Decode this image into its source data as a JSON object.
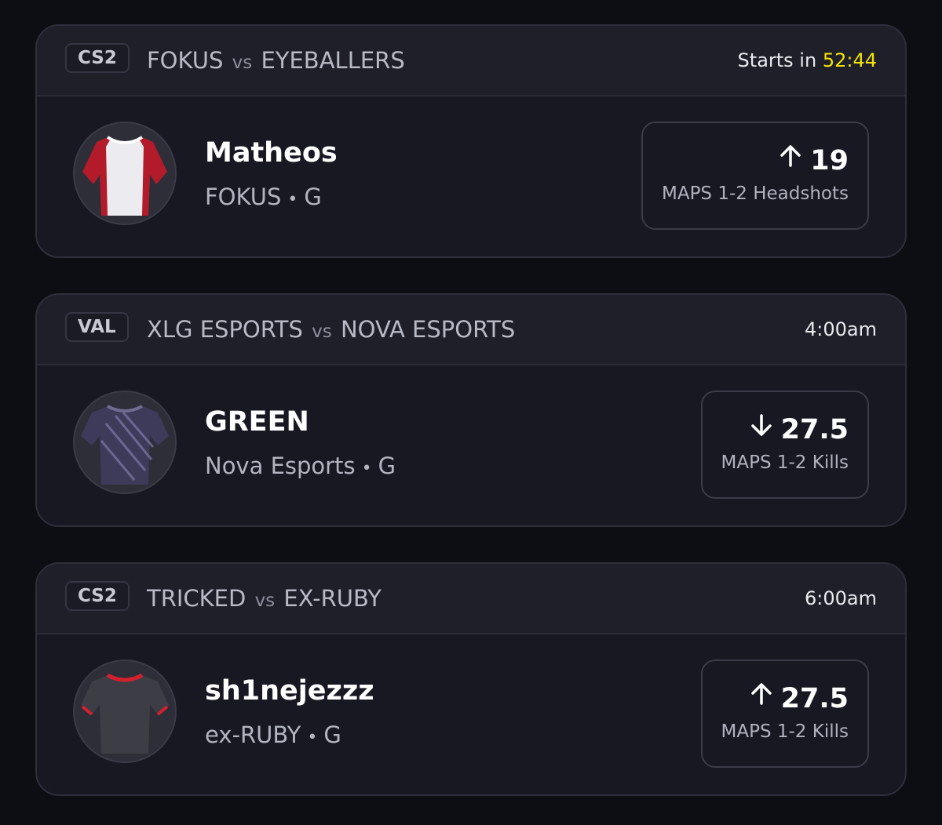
{
  "cards": [
    {
      "game": "CS2",
      "team_a": "FOKUS",
      "vs": "vs",
      "team_b": "EYEBALLERS",
      "time_prefix": "Starts in",
      "countdown": "52:44",
      "time": "",
      "player": "Matheos",
      "team": "FOKUS",
      "position": "G",
      "direction": "up",
      "arrow_icon": "arrow-up-icon",
      "line": "19",
      "stat": "MAPS 1-2 Headshots",
      "jersey_colors": [
        "#e8e8ec",
        "#b31b2a"
      ]
    },
    {
      "game": "VAL",
      "team_a": "XLG ESPORTS",
      "vs": "vs",
      "team_b": "NOVA ESPORTS",
      "time_prefix": "",
      "countdown": "",
      "time": "4:00am",
      "player": "GREEN",
      "team": "Nova Esports",
      "position": "G",
      "direction": "down",
      "arrow_icon": "arrow-down-icon",
      "line": "27.5",
      "stat": "MAPS 1-2 Kills",
      "jersey_colors": [
        "#3e3a5a",
        "#8a86b4"
      ]
    },
    {
      "game": "CS2",
      "team_a": "TRICKED",
      "vs": "vs",
      "team_b": "EX-RUBY",
      "time_prefix": "",
      "countdown": "",
      "time": "6:00am",
      "player": "sh1nejezzz",
      "team": "ex-RUBY",
      "position": "G",
      "direction": "up",
      "arrow_icon": "arrow-up-icon",
      "line": "27.5",
      "stat": "MAPS 1-2 Kills",
      "jersey_colors": [
        "#3d3d45",
        "#d2202f"
      ]
    }
  ],
  "separator": "•"
}
